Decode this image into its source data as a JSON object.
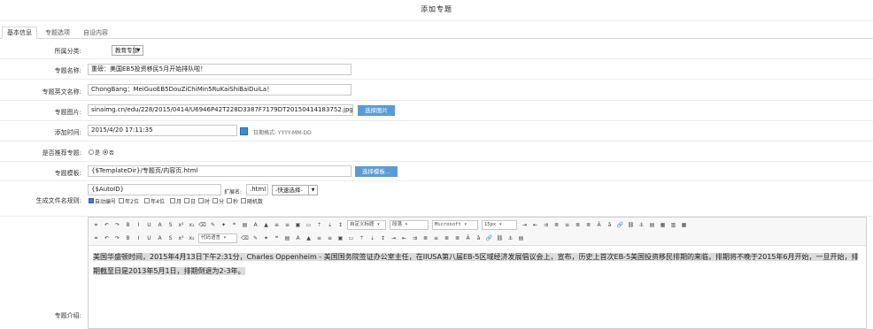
{
  "header": {
    "title": "添加专题"
  },
  "tabs": [
    "基本信息",
    "专题选项",
    "自设内容"
  ],
  "form": {
    "category": {
      "label": "所属分类:",
      "value": "教育专题"
    },
    "name": {
      "label": "专题名称:",
      "value": "重磅：美国EB5投资移民5月开始排队啦！"
    },
    "english_name": {
      "label": "专题英文名称:",
      "value": "ChongBang：MeiGuoEB5DouZiChiMin5RuKaiShiBaiDuiLa！"
    },
    "image": {
      "label": "专题图片:",
      "value": "sinaimg.cn/edu/228/2015/0414/U6946P42T228D3387F7179DT20150414183752.jpg",
      "button": "选择图片"
    },
    "add_time": {
      "label": "添加时间:",
      "value": "2015/4/20 17:11:35",
      "format_hint": "日期格式: YYYY-MM-DD"
    },
    "recommend": {
      "label": "是否推荐专题:",
      "options": [
        "是",
        "否"
      ],
      "selected": "否"
    },
    "template": {
      "label": "专题模板:",
      "value": "{$TemplateDir}/专题页/内容页.html",
      "button": "选择模板..."
    },
    "filename_rule": {
      "label": "生成文件名规则:",
      "value": "{$AutoID}",
      "ext_label": "扩展名:",
      "ext_value": ".html",
      "quick_select": "-快速选择-",
      "checkboxes": [
        "自动编号",
        "年2位",
        "年4位",
        "月",
        "日",
        "时",
        "分",
        "秒",
        "随机数"
      ],
      "checked": [
        "自动编号"
      ]
    },
    "intro": {
      "label": "专题介绍:"
    }
  },
  "editor": {
    "dropdowns": [
      "代码语言",
      "自定义标题",
      "段落",
      "Microsoft",
      "15px"
    ],
    "icons_row1": [
      "html-icon",
      "undo-icon",
      "redo-icon",
      "bold-icon",
      "italic-icon",
      "underline-icon",
      "font-border-icon",
      "strikethrough-icon",
      "superscript-icon",
      "subscript-icon",
      "eraser-icon",
      "format-match-icon",
      "auto-format-icon",
      "blockquote-icon",
      "paste-plain-icon",
      "font-color-icon",
      "background-color-icon",
      "ordered-list-icon",
      "unordered-list-icon",
      "select-all-icon",
      "clear-doc-icon",
      "row-spacing-top-icon",
      "row-spacing-bottom-icon",
      "line-height-icon",
      "ltr-icon",
      "rtl-icon",
      "indent-icon",
      "align-left-icon",
      "align-center-icon",
      "align-right-icon",
      "align-justify-icon",
      "touppercase-icon",
      "tolowercase-icon",
      "link-icon",
      "unlink-icon",
      "anchor-icon",
      "image-left-icon",
      "image-none-icon",
      "image-right-icon",
      "image-center-icon"
    ],
    "icons_row2": [
      "insert-image-icon",
      "multi-image-icon",
      "emotion-icon",
      "scrawl-icon",
      "insert-video-icon",
      "insert-music-icon",
      "attachment-icon",
      "map-icon",
      "gmap-icon",
      "insert-frame-icon",
      "code-icon",
      "page-break-icon",
      "horizontal-icon",
      "date-icon",
      "time-icon",
      "special-char-icon",
      "snapscreen-icon",
      "word-image-icon",
      "table-icon",
      "delete-table-icon",
      "insert-row-icon",
      "delete-row-icon",
      "insert-col-icon",
      "delete-col-icon",
      "merge-cells-icon",
      "merge-right-icon",
      "merge-down-icon",
      "split-cells-icon",
      "split-rows-icon",
      "split-cols-icon",
      "chart-icon",
      "print-icon",
      "preview-icon",
      "search-replace-icon",
      "help-icon",
      "template-icon",
      "background-icon"
    ],
    "content": "美国华盛顿时间，2015年4月13日下午2:31分，Charles Oppenheim - 美国国务院签证办公室主任，在IIUSA第八届EB-5区域经济发展倡议会上，宣布，历史上首次EB-5美国投资移民排期的来临，排期将不晚于2015年6月开始，一旦开始，排期截至日是2013年5月1日，排期倒退为2-3年。"
  }
}
